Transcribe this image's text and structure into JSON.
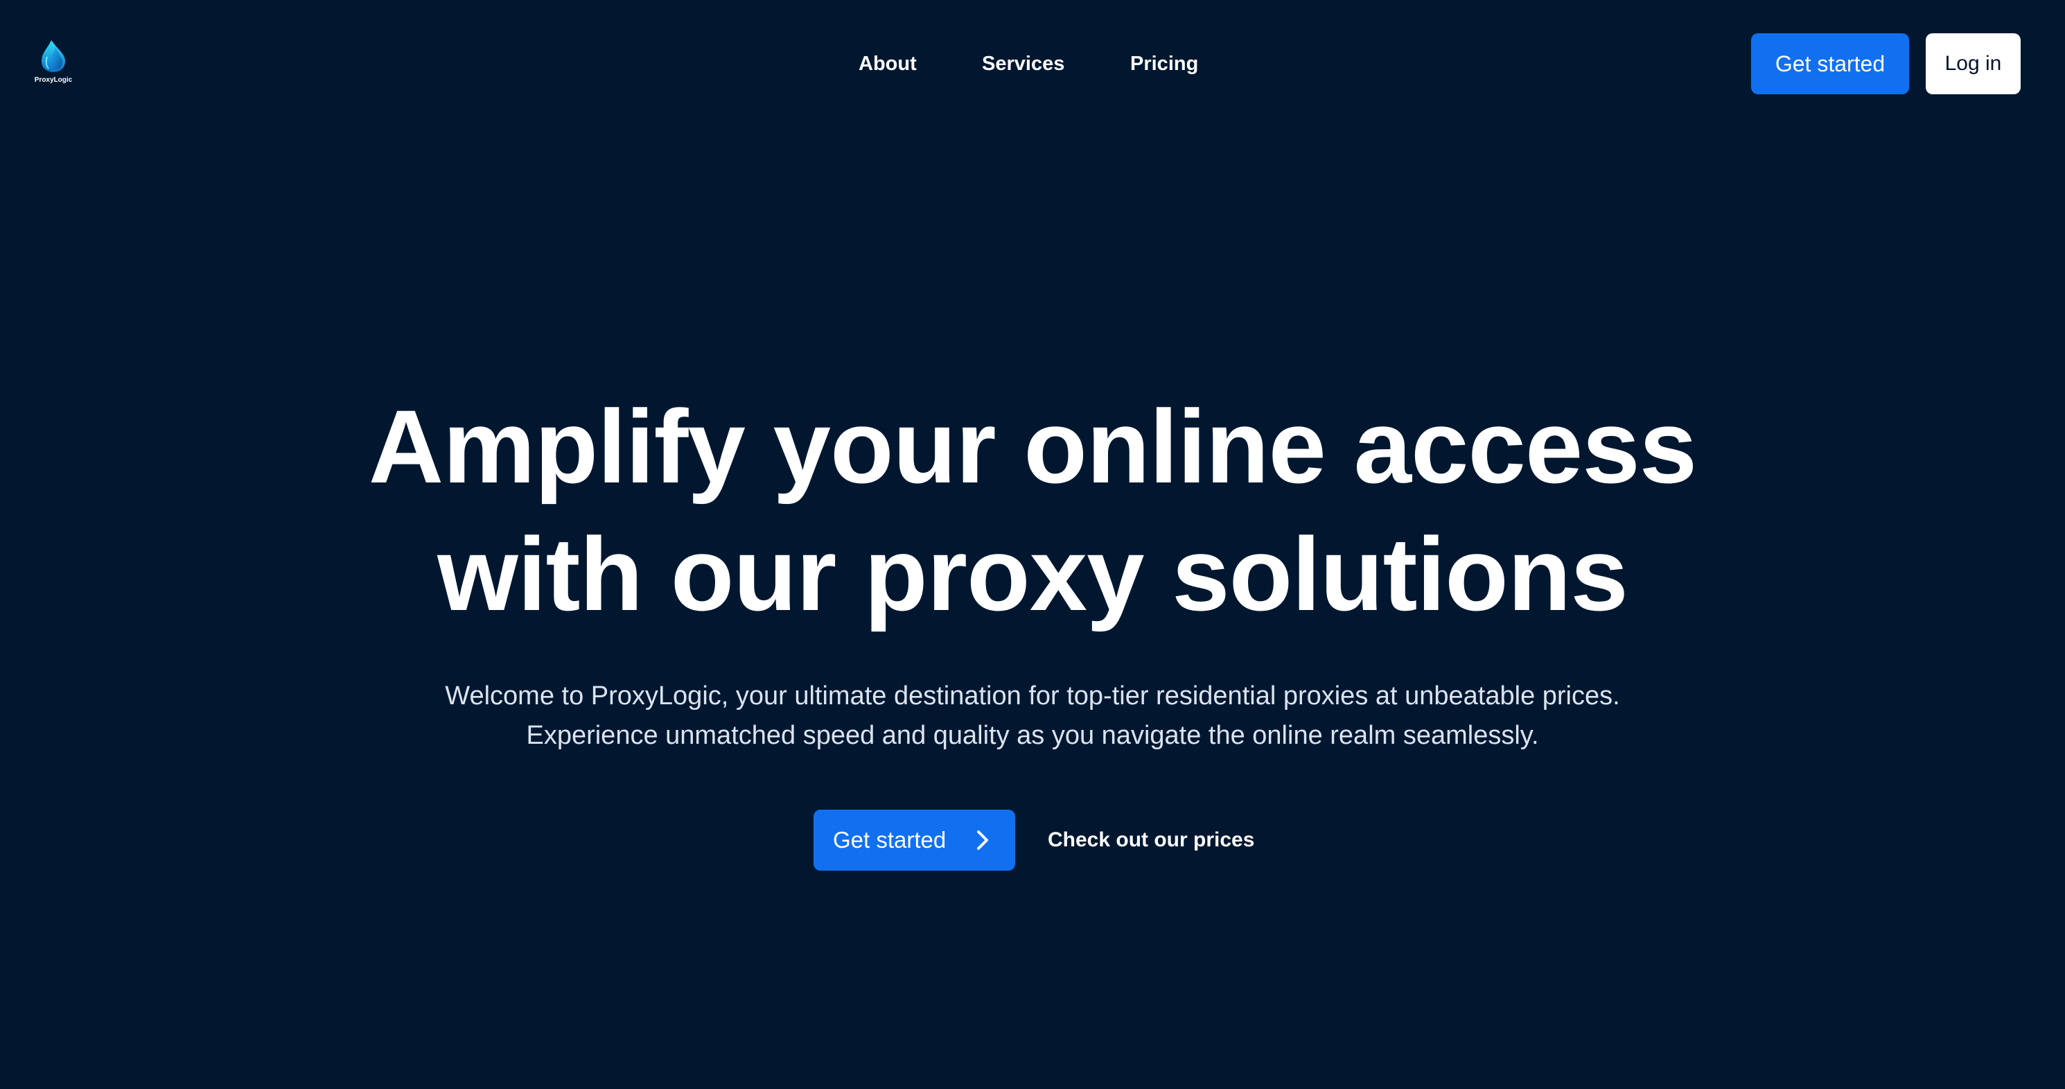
{
  "brand": {
    "name": "ProxyLogic",
    "logo_icon": "flame-drop-icon",
    "logo_colors": [
      "#1fb6ff",
      "#0a7bd6",
      "#34e0f5"
    ]
  },
  "nav": {
    "items": [
      {
        "label": "About"
      },
      {
        "label": "Services"
      },
      {
        "label": "Pricing"
      }
    ]
  },
  "header_actions": {
    "get_started_label": "Get started",
    "login_label": "Log in"
  },
  "hero": {
    "title_line1": "Amplify your online access",
    "title_line2": "with our proxy solutions",
    "subtitle_line1": "Welcome to ProxyLogic, your ultimate destination for top-tier residential proxies at unbeatable prices.",
    "subtitle_line2": "Experience unmatched speed and quality as you navigate the online realm seamlessly.",
    "primary_cta_label": "Get started",
    "primary_cta_icon": "chevron-right-icon",
    "secondary_cta_label": "Check out our prices"
  },
  "colors": {
    "background": "#011730",
    "accent": "#1170f0",
    "text": "#ffffff",
    "muted_text": "#dbe3f0"
  }
}
